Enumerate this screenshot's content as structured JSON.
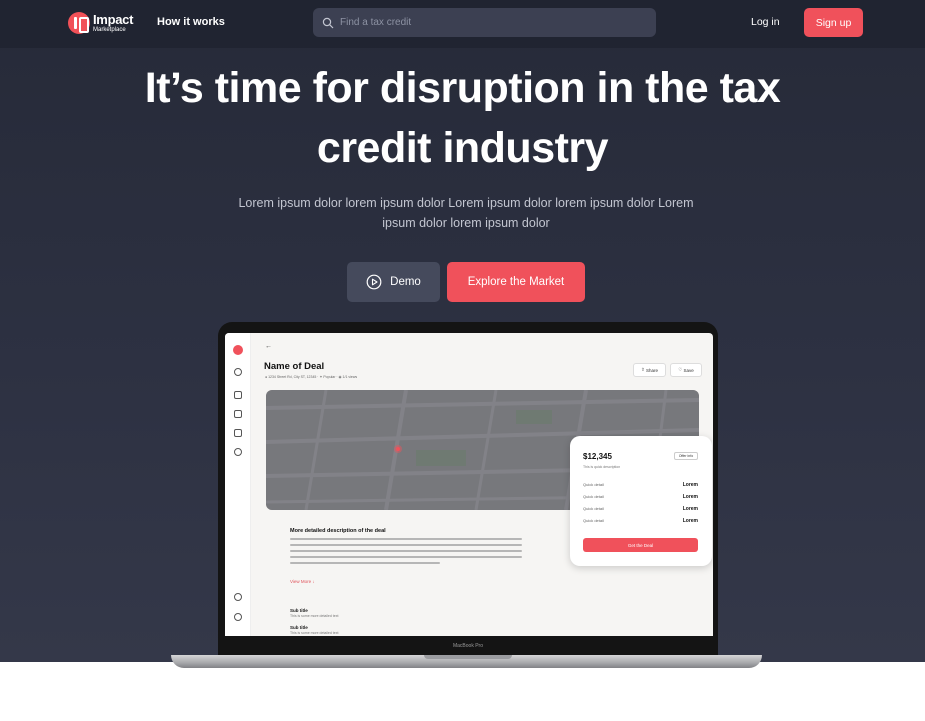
{
  "nav": {
    "brand_name": "Impact",
    "brand_sub": "Marketplace",
    "how_it_works": "How it works",
    "search_placeholder": "Find a tax credit",
    "login": "Log in",
    "signup": "Sign up"
  },
  "hero": {
    "headline_line1": "It’s time for disruption in the tax",
    "headline_line2": "credit industry",
    "subtitle": "Lorem ipsum dolor lorem ipsum dolor Lorem ipsum dolor lorem ipsum dolor Lorem ipsum dolor lorem ipsum dolor",
    "demo_button": "Demo",
    "explore_button": "Explore the Market"
  },
  "device": {
    "label": "MacBook Pro"
  },
  "app_preview": {
    "back": "←",
    "deal_title": "Name of Deal",
    "meta": "● 1234 Street Rd, City ST, 12345   ·   ✦ Popular   ·   ◉ 1/1 views",
    "share": "Share",
    "save": "Save",
    "description_title": "More detailed description of the deal",
    "view_more": "View More ↓",
    "subtitles": [
      {
        "title": "Sub title",
        "text": "This is some more detailed text"
      },
      {
        "title": "Sub title",
        "text": "This is some more detailed text"
      }
    ],
    "card": {
      "price": "$12,345",
      "price_desc": "This is quick description",
      "offer": "Offer info",
      "details": [
        {
          "label": "Quick detail",
          "value": "Lorem"
        },
        {
          "label": "Quick detail",
          "value": "Lorem"
        },
        {
          "label": "Quick detail",
          "value": "Lorem"
        },
        {
          "label": "Quick detail",
          "value": "Lorem"
        }
      ],
      "cta": "Get the Deal"
    }
  },
  "colors": {
    "background_top": "#262a38",
    "accent": "#f0515b",
    "demo_button": "#454a5c",
    "search_bg": "#3c4052"
  }
}
